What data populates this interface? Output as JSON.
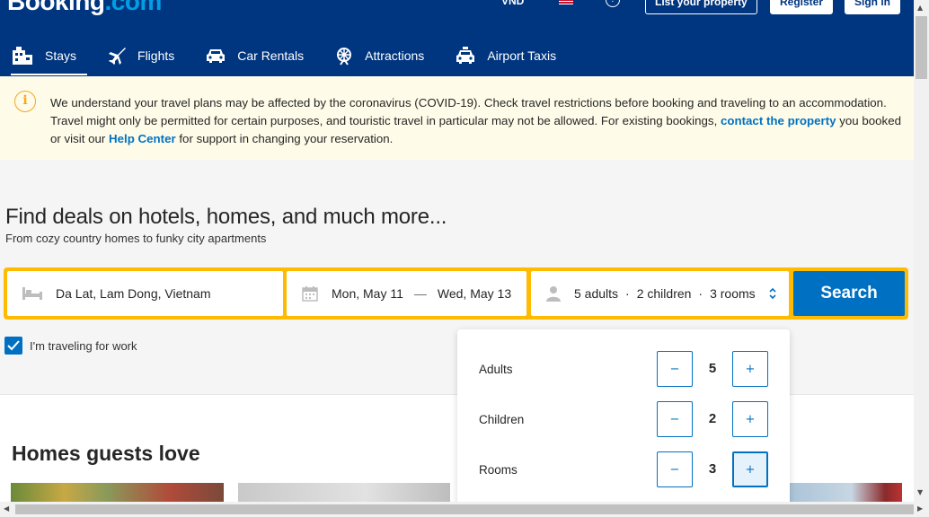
{
  "header": {
    "logo_main": "Booking",
    "logo_dot": ".com",
    "currency": "VND",
    "help_glyph": "?",
    "list_property": "List your property",
    "register": "Register",
    "sign_in": "Sign in",
    "nav": [
      {
        "label": "Stays",
        "icon": "bed-icon",
        "active": true
      },
      {
        "label": "Flights",
        "icon": "plane-icon",
        "active": false
      },
      {
        "label": "Car Rentals",
        "icon": "car-icon",
        "active": false
      },
      {
        "label": "Attractions",
        "icon": "attractions-icon",
        "active": false
      },
      {
        "label": "Airport Taxis",
        "icon": "taxi-icon",
        "active": false
      }
    ]
  },
  "notice": {
    "icon_glyph": "i",
    "text_before": "We understand your travel plans may be affected by the coronavirus (COVID-19). Check travel restrictions before booking and traveling to an accommodation. Travel might only be permitted for certain purposes, and touristic travel in particular may not be allowed. For existing bookings, ",
    "link1": "contact the property",
    "text_middle": " you booked or visit our ",
    "link2": "Help Center",
    "text_after": " for support in changing your reservation."
  },
  "hero": {
    "title": "Find deals on hotels, homes, and much more...",
    "subtitle": "From cozy country homes to funky city apartments"
  },
  "search": {
    "destination": "Da Lat, Lam Dong, Vietnam",
    "checkin": "Mon, May 11",
    "dash": "—",
    "checkout": "Wed, May 13",
    "adults_summary": "5 adults",
    "children_summary": "2 children",
    "rooms_summary": "3 rooms",
    "separator": "·",
    "button": "Search"
  },
  "work_travel": {
    "label": "I'm traveling for work",
    "checked": true
  },
  "guests_popover": {
    "rows": [
      {
        "label": "Adults",
        "value": "5"
      },
      {
        "label": "Children",
        "value": "2"
      },
      {
        "label": "Rooms",
        "value": "3"
      }
    ],
    "minus_glyph": "−",
    "plus_glyph": "+"
  },
  "homes": {
    "title": "Homes guests love"
  },
  "colors": {
    "brand_blue": "#003580",
    "accent_blue": "#0071c2",
    "search_yellow": "#febb02",
    "notice_bg": "#fefbe8"
  }
}
